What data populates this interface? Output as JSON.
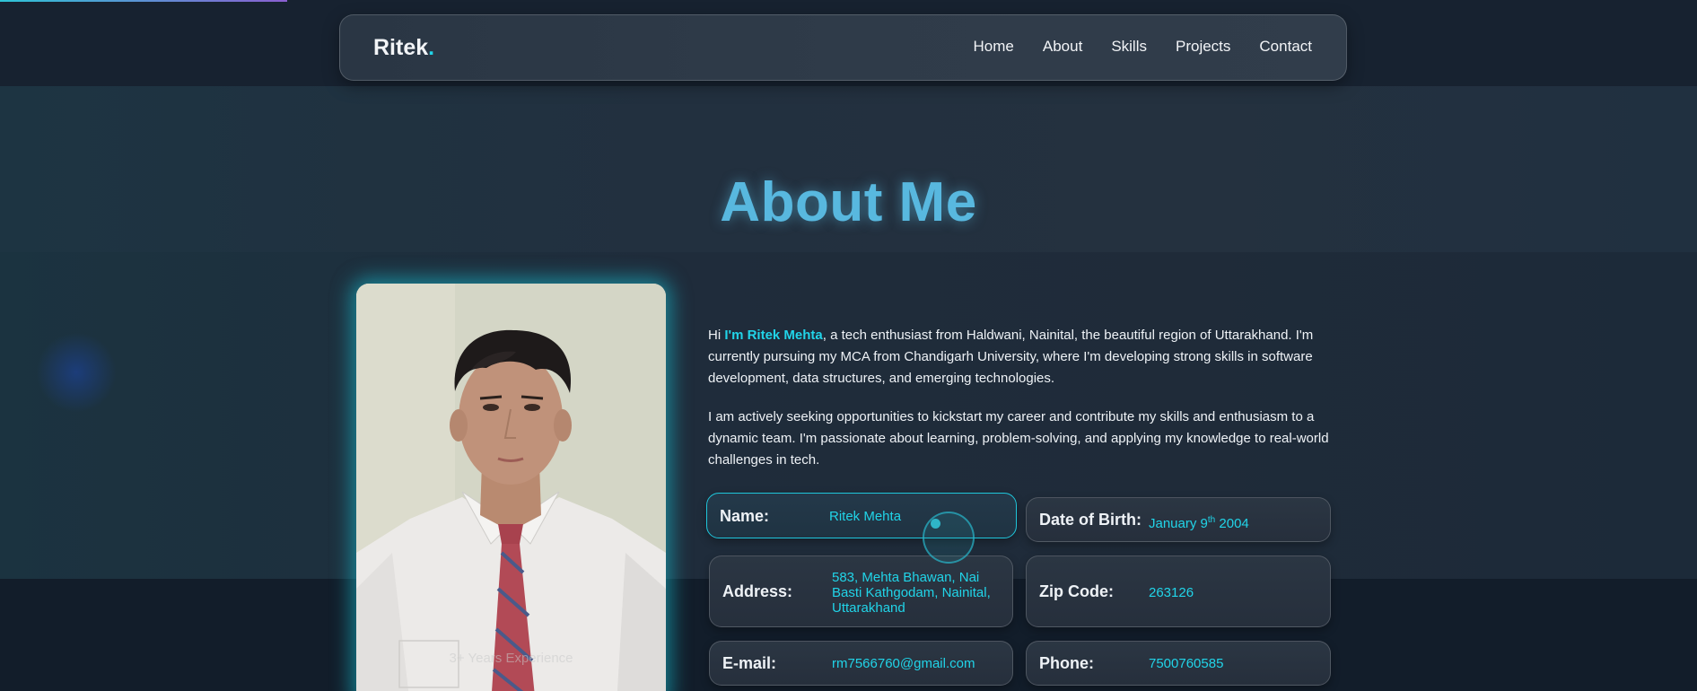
{
  "navbar": {
    "brand_name": "Ritek",
    "brand_dot": ".",
    "links": [
      "Home",
      "About",
      "Skills",
      "Projects",
      "Contact"
    ]
  },
  "about": {
    "title": "About Me",
    "photo_caption": "3+ Years Experience",
    "bio": {
      "p1_prefix": "Hi ",
      "p1_highlight": "I'm Ritek Mehta",
      "p1_rest": ", a tech enthusiast from Haldwani, Nainital, the beautiful region of Uttarakhand. I'm currently pursuing my MCA from Chandigarh University, where I'm developing strong skills in software development, data structures, and emerging technologies.",
      "p2": "I am actively seeking opportunities to kickstart my career and contribute my skills and enthusiasm to a dynamic team. I'm passionate about learning, problem-solving, and applying my knowledge to real-world challenges in tech."
    },
    "info": {
      "name_label": "Name:",
      "name_value": "Ritek Mehta",
      "dob_label": "Date of Birth:",
      "dob_value_prefix": "January 9",
      "dob_value_sup": "th",
      "dob_value_suffix": " 2004",
      "address_label": "Address:",
      "address_value": "583, Mehta Bhawan, Nai Basti Kathgodam, Nainital, Uttarakhand",
      "zip_label": "Zip Code:",
      "zip_value": "263126",
      "email_label": "E-mail:",
      "email_value": "rm7566760@gmail.com",
      "phone_label": "Phone:",
      "phone_value": "7500760585"
    }
  },
  "colors": {
    "accent": "#21d4e8",
    "title": "#58b8df",
    "background": "#16202d"
  }
}
